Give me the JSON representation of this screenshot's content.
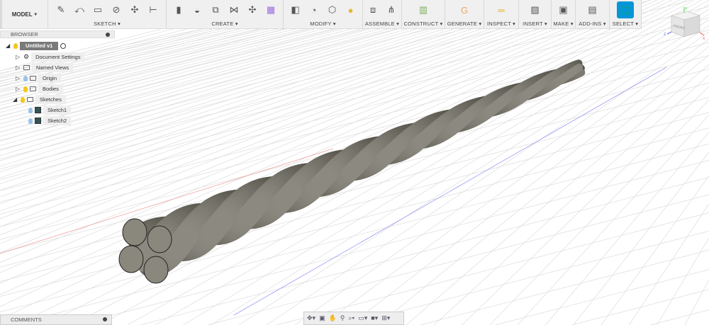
{
  "toolbar": {
    "model_label": "MODEL",
    "groups": [
      {
        "label": "SKETCH",
        "icons": [
          "create-sketch-icon",
          "line-icon",
          "rectangle-icon",
          "circle-icon",
          "pattern-icon",
          "dimension-icon"
        ]
      },
      {
        "label": "CREATE",
        "icons": [
          "extrude-icon",
          "revolve-icon",
          "sweep-icon",
          "loft-icon",
          "pipe-icon",
          "form-icon"
        ]
      },
      {
        "label": "MODIFY",
        "icons": [
          "press-pull-icon",
          "fillet-icon",
          "chamfer-icon",
          "appearance-icon"
        ]
      },
      {
        "label": "ASSEMBLE",
        "icons": [
          "new-component-icon",
          "joint-icon"
        ]
      },
      {
        "label": "CONSTRUCT",
        "icons": [
          "offset-plane-icon"
        ]
      },
      {
        "label": "GENERATE",
        "icons": [
          "generative-design-icon"
        ]
      },
      {
        "label": "INSPECT",
        "icons": [
          "measure-icon"
        ]
      },
      {
        "label": "INSERT",
        "icons": [
          "insert-image-icon"
        ]
      },
      {
        "label": "MAKE",
        "icons": [
          "3d-print-icon"
        ]
      },
      {
        "label": "ADD-INS",
        "icons": [
          "scripts-icon"
        ]
      },
      {
        "label": "SELECT",
        "icons": [
          "select-icon"
        ]
      }
    ]
  },
  "browser": {
    "title": "BROWSER",
    "root": "Untitled v1",
    "items": [
      {
        "label": "Document Settings"
      },
      {
        "label": "Named Views"
      },
      {
        "label": "Origin"
      },
      {
        "label": "Bodies"
      },
      {
        "label": "Sketches"
      },
      {
        "label": "Sketch1"
      },
      {
        "label": "Sketch2"
      }
    ]
  },
  "comments": {
    "title": "COMMENTS"
  },
  "viewcube": {
    "face": "FRONT",
    "axes": [
      "X",
      "Y",
      "Z"
    ]
  },
  "colors": {
    "select_active": "#0696d7",
    "strand": "#8a877c",
    "x_axis": "#e05050",
    "z_axis": "#6a6af0"
  }
}
